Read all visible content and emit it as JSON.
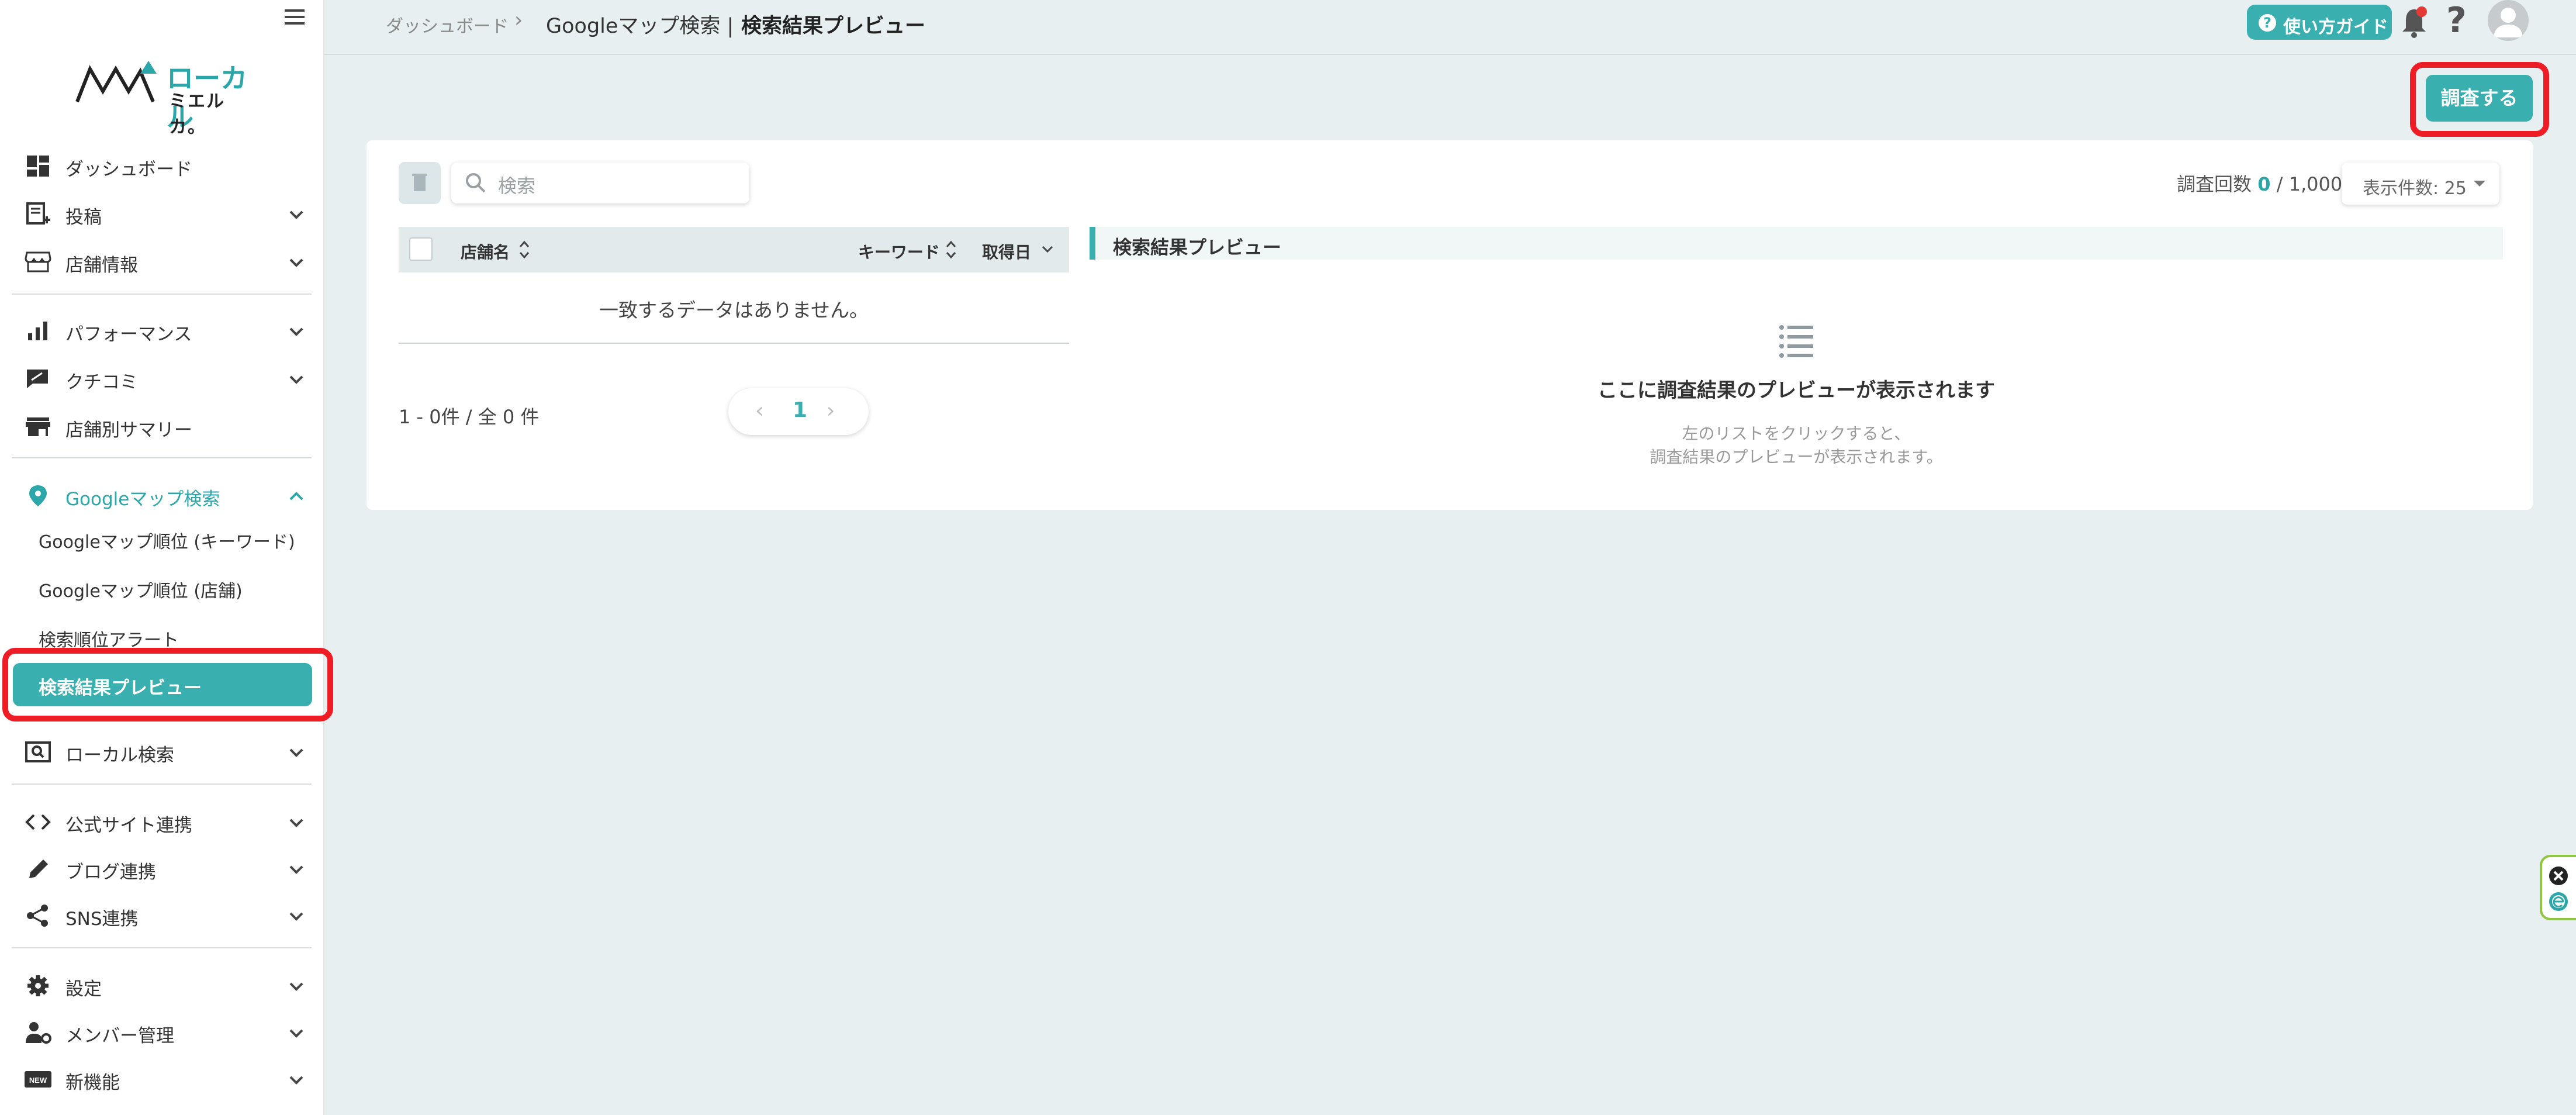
{
  "sidebar": {
    "logo": {
      "line1": "ローカル",
      "line2": "ミエルカ。"
    },
    "items": [
      {
        "label": "ダッシュボード"
      },
      {
        "label": "投稿"
      },
      {
        "label": "店舗情報"
      },
      {
        "label": "パフォーマンス"
      },
      {
        "label": "クチコミ"
      },
      {
        "label": "店舗別サマリー"
      },
      {
        "label": "Googleマップ検索"
      },
      {
        "label": "ローカル検索"
      },
      {
        "label": "公式サイト連携"
      },
      {
        "label": "ブログ連携"
      },
      {
        "label": "SNS連携"
      },
      {
        "label": "設定"
      },
      {
        "label": "メンバー管理"
      },
      {
        "label": "新機能"
      }
    ],
    "google_sub": [
      {
        "label": "Googleマップ順位 (キーワード)"
      },
      {
        "label": "Googleマップ順位 (店舗)"
      },
      {
        "label": "検索順位アラート"
      },
      {
        "label": "検索結果プレビュー"
      }
    ],
    "new_badge": "NEW"
  },
  "header": {
    "breadcrumb": [
      "ダッシュボード",
      "Googleマップ検索 |",
      "検索結果プレビュー"
    ],
    "guide_label": "使い方ガイド",
    "help_label": "?"
  },
  "toolbar": {
    "investigate_label": "調査する",
    "search_placeholder": "検索",
    "count_label": "調査回数",
    "count_used": "0",
    "count_total": "/ 1,000",
    "per_page_label": "表示件数: 25"
  },
  "table": {
    "columns": [
      "店舗名",
      "キーワード",
      "取得日"
    ],
    "empty_message": "一致するデータはありません。",
    "range_text": "1 - 0件 / 全 0 件",
    "page": "1"
  },
  "preview": {
    "heading": "検索結果プレビュー",
    "empty_title": "ここに調査結果のプレビューが表示されます",
    "empty_line1": "左のリストをクリックすると、",
    "empty_line2": "調査結果のプレビューが表示されます。"
  },
  "colors": {
    "accent": "#3aafb0",
    "highlight": "#ee1c24",
    "background": "#e8eff0"
  }
}
